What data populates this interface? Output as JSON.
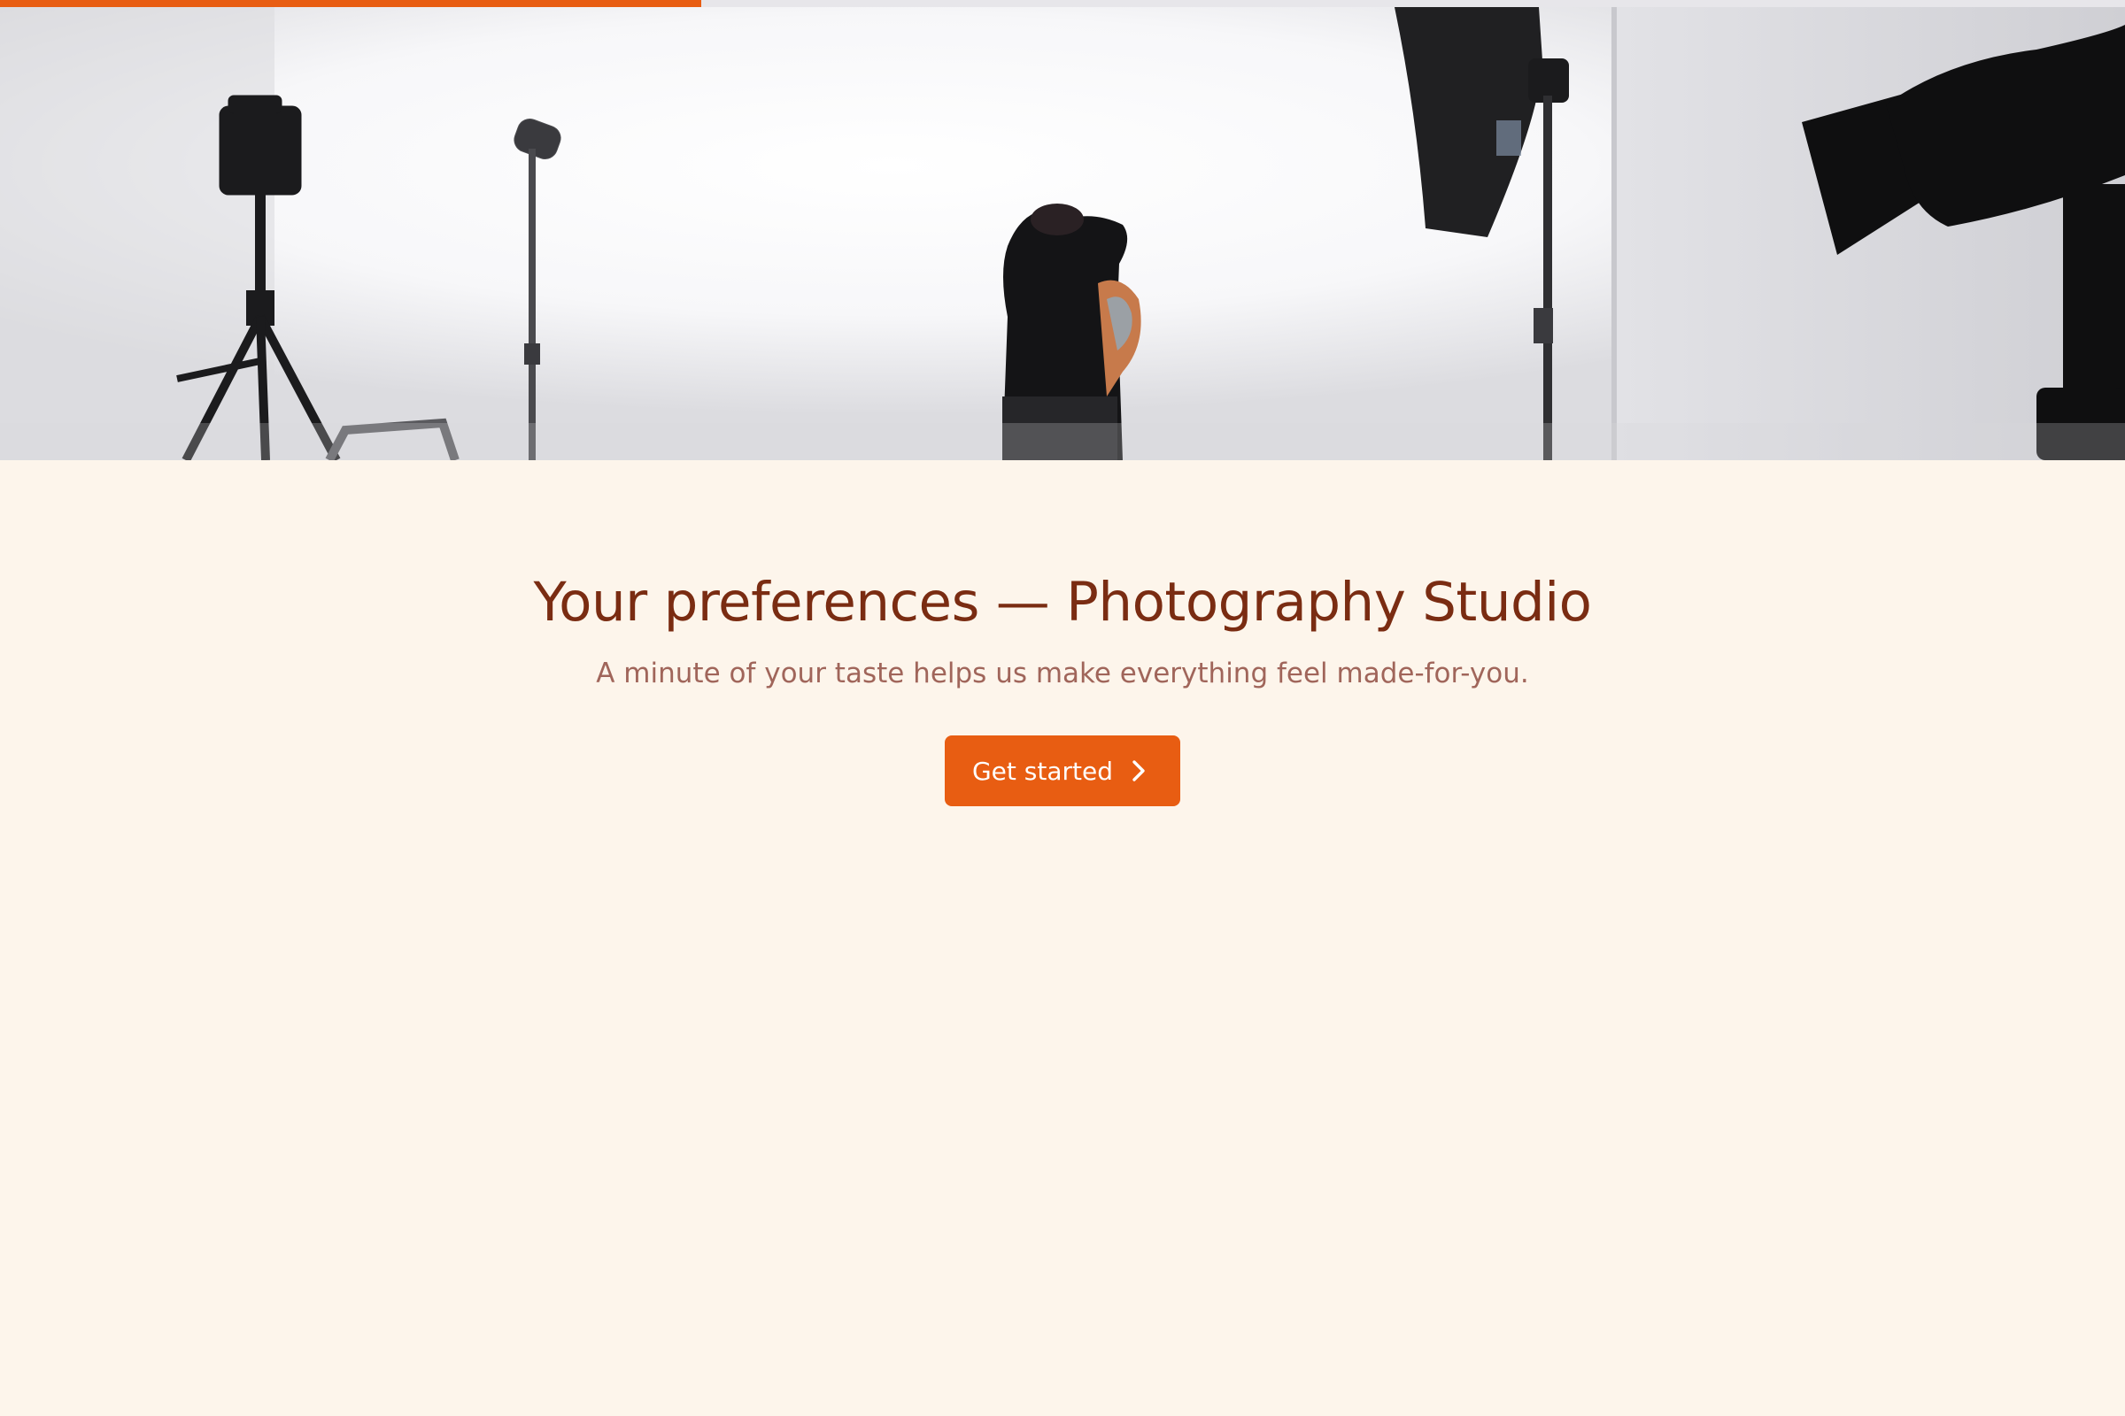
{
  "progress": {
    "fraction": 0.33
  },
  "hero": {
    "scene": "photography studio with light stands, softbox and model"
  },
  "main": {
    "title": "Your preferences — Photography Studio",
    "subtitle": "A minute of your taste helps us make everything feel made-for-you.",
    "cta_label": "Get started",
    "cta_icon": "chevron-right-icon"
  },
  "colors": {
    "accent": "#e85d12",
    "background": "#fdf5eb",
    "title": "#7a2c12",
    "subtitle": "#a0655a",
    "progress_track": "#e7e6ea"
  }
}
